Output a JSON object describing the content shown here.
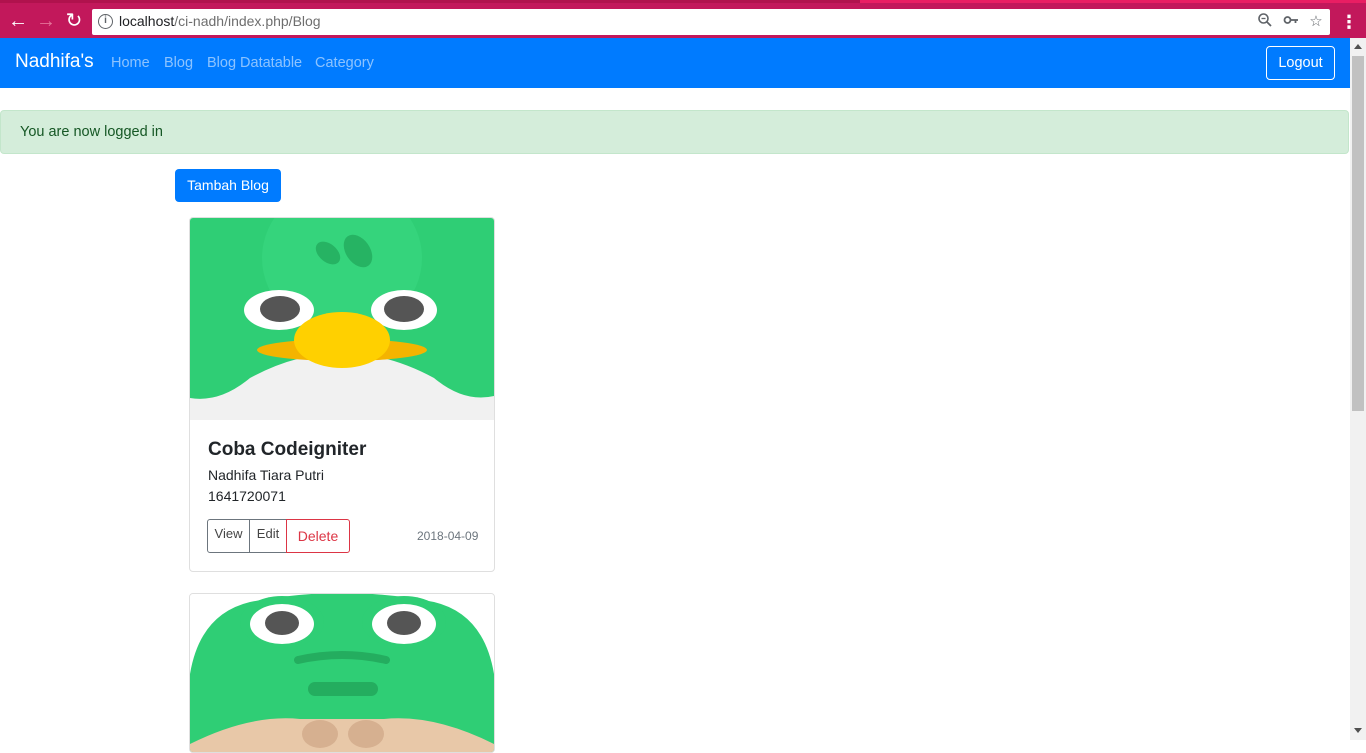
{
  "browser": {
    "url_host": "localhost",
    "url_path": "/ci-nadh/index.php/Blog"
  },
  "navbar": {
    "brand": "Nadhifa's",
    "links": [
      "Home",
      "Blog",
      "Blog Datatable",
      "Category"
    ],
    "logout_label": "Logout"
  },
  "alert": {
    "message": "You are now logged in"
  },
  "actions": {
    "add_blog_label": "Tambah Blog"
  },
  "cards": [
    {
      "title": "Coba Codeigniter",
      "author": "Nadhifa Tiara Putri",
      "nim": "1641720071",
      "date": "2018-04-09",
      "buttons": {
        "view": "View",
        "edit": "Edit",
        "delete": "Delete"
      }
    }
  ],
  "colors": {
    "primary": "#007bff",
    "browser_frame": "#c2185b",
    "alert_bg": "#d4edda",
    "danger": "#dc3545"
  }
}
